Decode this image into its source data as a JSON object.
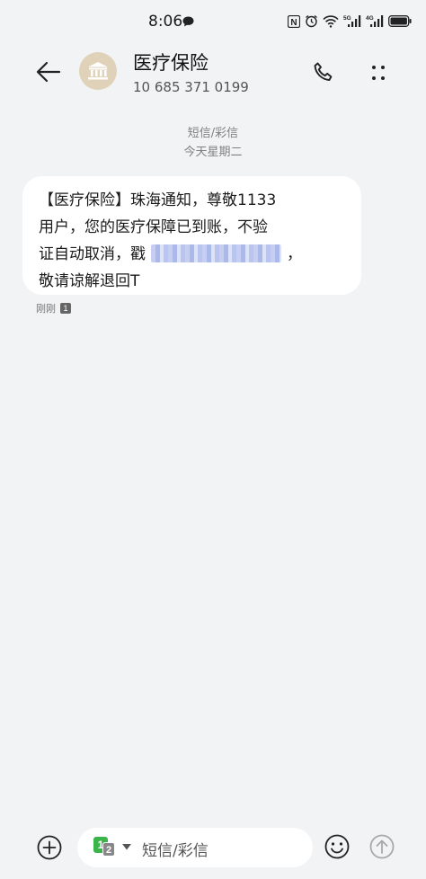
{
  "status_bar": {
    "time": "8:06",
    "network_5g": "5G",
    "network_4g": "4G",
    "nfc": "N"
  },
  "header": {
    "contact_name": "医疗保险",
    "contact_number": "10 685 371 0199",
    "icons": [
      "back-arrow-icon",
      "bank-icon",
      "phone-icon",
      "more-icon"
    ]
  },
  "conversation": {
    "type_label": "短信/彩信",
    "date_label": "今天星期二"
  },
  "message": {
    "lines": [
      "【医疗保险】珠海通知，尊敬1133",
      "用户，您的医疗保障已到账，不验",
      "证自动取消，戳",
      "，",
      "敬请谅解退回T"
    ],
    "time": "刚刚",
    "sim": "1"
  },
  "composer": {
    "placeholder": "短信/彩信",
    "sim_primary": "1",
    "sim_secondary": "2",
    "sim1_color": "#3bb54a"
  }
}
